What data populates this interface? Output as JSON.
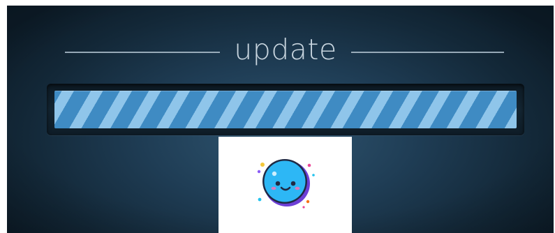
{
  "header": {
    "title": "update"
  },
  "progress": {
    "fill_fraction": 1.0,
    "stripe_colors": {
      "light": "#8fc5ea",
      "dark": "#3f8bc3"
    }
  },
  "overlay": {
    "icon": "smiley-face-icon"
  },
  "colors": {
    "background": "#1f3d55",
    "title_text": "#c8d5df",
    "rule": "#aebfcc"
  }
}
